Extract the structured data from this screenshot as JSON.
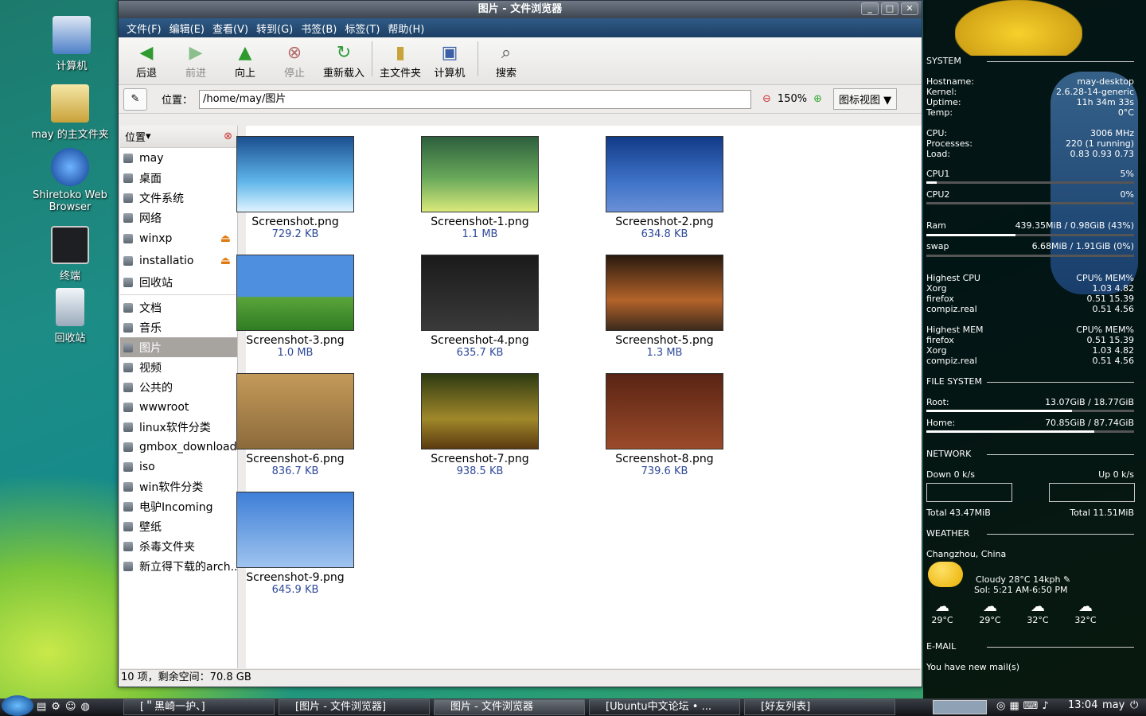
{
  "desktop": {
    "icons": [
      "计算机",
      "may 的主文件夹",
      "Shiretoko Web Browser",
      "终端",
      "回收站"
    ]
  },
  "window": {
    "title": "图片 - 文件浏览器"
  },
  "menu": [
    "文件(F)",
    "编辑(E)",
    "查看(V)",
    "转到(G)",
    "书签(B)",
    "标签(T)",
    "帮助(H)"
  ],
  "toolbar": {
    "back": "后退",
    "forward": "前进",
    "up": "向上",
    "stop": "停止",
    "reload": "重新载入",
    "home": "主文件夹",
    "computer": "计算机",
    "search": "搜索"
  },
  "location": {
    "label": "位置：",
    "path": "/home/may/图片",
    "zoom": "150%",
    "view": "图标视图"
  },
  "sidebar": {
    "header": "位置",
    "places": [
      "may",
      "桌面",
      "文件系统",
      "网络",
      "winxp",
      "installatio",
      "回收站"
    ],
    "bookmarks": [
      "文档",
      "音乐",
      "图片",
      "视频",
      "公共的",
      "wwwroot",
      "linux软件分类",
      "gmbox_download",
      "iso",
      "win软件分类",
      "电驴Incoming",
      "壁纸",
      "杀毒文件夹",
      "新立得下载的arch..."
    ],
    "selected": "图片"
  },
  "files": [
    {
      "name": "Screenshot.png",
      "size": "729.2 KB"
    },
    {
      "name": "Screenshot-1.png",
      "size": "1.1 MB"
    },
    {
      "name": "Screenshot-2.png",
      "size": "634.8 KB"
    },
    {
      "name": "Screenshot-3.png",
      "size": "1.0 MB"
    },
    {
      "name": "Screenshot-4.png",
      "size": "635.7 KB"
    },
    {
      "name": "Screenshot-5.png",
      "size": "1.3 MB"
    },
    {
      "name": "Screenshot-6.png",
      "size": "836.7 KB"
    },
    {
      "name": "Screenshot-7.png",
      "size": "938.5 KB"
    },
    {
      "name": "Screenshot-8.png",
      "size": "739.6 KB"
    },
    {
      "name": "Screenshot-9.png",
      "size": "645.9 KB"
    }
  ],
  "status": "10 项，剩余空间：70.8 GB",
  "conky": {
    "system": "SYSTEM",
    "hostname_l": "Hostname:",
    "hostname": "may-desktop",
    "kernel_l": "Kernel:",
    "kernel": "2.6.28-14-generic",
    "uptime_l": "Uptime:",
    "uptime": "11h 34m 33s",
    "temp_l": "Temp:",
    "temp": "0°C",
    "cpu_l": "CPU:",
    "cpu": "3006 MHz",
    "proc_l": "Processes:",
    "proc": "220 (1 running)",
    "load_l": "Load:",
    "load": "0.83 0.93 0.73",
    "cpu1_l": "CPU1",
    "cpu1": "5%",
    "cpu2_l": "CPU2",
    "cpu2": "0%",
    "cpu1_frac": 0.05,
    "cpu2_frac": 0.0,
    "ram_l": "Ram",
    "ram": "439.35MiB / 0.98GiB (43%)",
    "ram_frac": 0.43,
    "swap_l": "swap",
    "swap": "6.68MiB / 1.91GiB (0%)",
    "swap_frac": 0.0,
    "hicpu_l": "Highest CPU",
    "hicpu_h": "CPU% MEM%",
    "hicpu": [
      [
        "Xorg",
        "1.03  4.82"
      ],
      [
        "firefox",
        "0.51 15.39"
      ],
      [
        "compiz.real",
        "0.51  4.56"
      ]
    ],
    "himem_l": "Highest MEM",
    "himem_h": "CPU% MEM%",
    "himem": [
      [
        "firefox",
        "0.51 15.39"
      ],
      [
        "Xorg",
        "1.03  4.82"
      ],
      [
        "compiz.real",
        "0.51  4.56"
      ]
    ],
    "fs": "FILE SYSTEM",
    "root_l": "Root:",
    "root": "13.07GiB / 18.77GiB",
    "root_frac": 0.7,
    "home_l": "Home:",
    "home": "70.85GiB / 87.74GiB",
    "home_frac": 0.81,
    "net": "NETWORK",
    "down": "Down 0 k/s",
    "up": "Up 0 k/s",
    "total_down": "Total 43.47MiB",
    "total_up": "Total 11.51MiB",
    "weather": "WEATHER",
    "city": "Changzhou, China",
    "now": "Cloudy   28°C   14kph",
    "sol": "Sol: 5:21 AM-6:50 PM",
    "fc": [
      "29°C",
      "29°C",
      "32°C",
      "32°C"
    ],
    "email": "E-MAIL",
    "mail": "You have  new mail(s)"
  },
  "taskbar": {
    "tasks": [
      "[＂黑崎一护、]",
      "[图片 - 文件浏览器]",
      "图片 - 文件浏览器",
      "[Ubuntu中文论坛 • ...",
      "[好友列表]"
    ],
    "time": "13:04",
    "user": "may"
  }
}
